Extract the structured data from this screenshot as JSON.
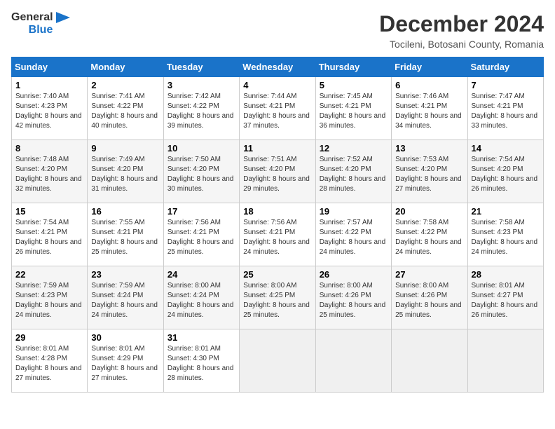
{
  "logo": {
    "text_general": "General",
    "text_blue": "Blue"
  },
  "title": {
    "month_year": "December 2024",
    "location": "Tocileni, Botosani County, Romania"
  },
  "weekdays": [
    "Sunday",
    "Monday",
    "Tuesday",
    "Wednesday",
    "Thursday",
    "Friday",
    "Saturday"
  ],
  "weeks": [
    [
      {
        "day": "1",
        "sunrise": "Sunrise: 7:40 AM",
        "sunset": "Sunset: 4:23 PM",
        "daylight": "Daylight: 8 hours and 42 minutes."
      },
      {
        "day": "2",
        "sunrise": "Sunrise: 7:41 AM",
        "sunset": "Sunset: 4:22 PM",
        "daylight": "Daylight: 8 hours and 40 minutes."
      },
      {
        "day": "3",
        "sunrise": "Sunrise: 7:42 AM",
        "sunset": "Sunset: 4:22 PM",
        "daylight": "Daylight: 8 hours and 39 minutes."
      },
      {
        "day": "4",
        "sunrise": "Sunrise: 7:44 AM",
        "sunset": "Sunset: 4:21 PM",
        "daylight": "Daylight: 8 hours and 37 minutes."
      },
      {
        "day": "5",
        "sunrise": "Sunrise: 7:45 AM",
        "sunset": "Sunset: 4:21 PM",
        "daylight": "Daylight: 8 hours and 36 minutes."
      },
      {
        "day": "6",
        "sunrise": "Sunrise: 7:46 AM",
        "sunset": "Sunset: 4:21 PM",
        "daylight": "Daylight: 8 hours and 34 minutes."
      },
      {
        "day": "7",
        "sunrise": "Sunrise: 7:47 AM",
        "sunset": "Sunset: 4:21 PM",
        "daylight": "Daylight: 8 hours and 33 minutes."
      }
    ],
    [
      {
        "day": "8",
        "sunrise": "Sunrise: 7:48 AM",
        "sunset": "Sunset: 4:20 PM",
        "daylight": "Daylight: 8 hours and 32 minutes."
      },
      {
        "day": "9",
        "sunrise": "Sunrise: 7:49 AM",
        "sunset": "Sunset: 4:20 PM",
        "daylight": "Daylight: 8 hours and 31 minutes."
      },
      {
        "day": "10",
        "sunrise": "Sunrise: 7:50 AM",
        "sunset": "Sunset: 4:20 PM",
        "daylight": "Daylight: 8 hours and 30 minutes."
      },
      {
        "day": "11",
        "sunrise": "Sunrise: 7:51 AM",
        "sunset": "Sunset: 4:20 PM",
        "daylight": "Daylight: 8 hours and 29 minutes."
      },
      {
        "day": "12",
        "sunrise": "Sunrise: 7:52 AM",
        "sunset": "Sunset: 4:20 PM",
        "daylight": "Daylight: 8 hours and 28 minutes."
      },
      {
        "day": "13",
        "sunrise": "Sunrise: 7:53 AM",
        "sunset": "Sunset: 4:20 PM",
        "daylight": "Daylight: 8 hours and 27 minutes."
      },
      {
        "day": "14",
        "sunrise": "Sunrise: 7:54 AM",
        "sunset": "Sunset: 4:20 PM",
        "daylight": "Daylight: 8 hours and 26 minutes."
      }
    ],
    [
      {
        "day": "15",
        "sunrise": "Sunrise: 7:54 AM",
        "sunset": "Sunset: 4:21 PM",
        "daylight": "Daylight: 8 hours and 26 minutes."
      },
      {
        "day": "16",
        "sunrise": "Sunrise: 7:55 AM",
        "sunset": "Sunset: 4:21 PM",
        "daylight": "Daylight: 8 hours and 25 minutes."
      },
      {
        "day": "17",
        "sunrise": "Sunrise: 7:56 AM",
        "sunset": "Sunset: 4:21 PM",
        "daylight": "Daylight: 8 hours and 25 minutes."
      },
      {
        "day": "18",
        "sunrise": "Sunrise: 7:56 AM",
        "sunset": "Sunset: 4:21 PM",
        "daylight": "Daylight: 8 hours and 24 minutes."
      },
      {
        "day": "19",
        "sunrise": "Sunrise: 7:57 AM",
        "sunset": "Sunset: 4:22 PM",
        "daylight": "Daylight: 8 hours and 24 minutes."
      },
      {
        "day": "20",
        "sunrise": "Sunrise: 7:58 AM",
        "sunset": "Sunset: 4:22 PM",
        "daylight": "Daylight: 8 hours and 24 minutes."
      },
      {
        "day": "21",
        "sunrise": "Sunrise: 7:58 AM",
        "sunset": "Sunset: 4:23 PM",
        "daylight": "Daylight: 8 hours and 24 minutes."
      }
    ],
    [
      {
        "day": "22",
        "sunrise": "Sunrise: 7:59 AM",
        "sunset": "Sunset: 4:23 PM",
        "daylight": "Daylight: 8 hours and 24 minutes."
      },
      {
        "day": "23",
        "sunrise": "Sunrise: 7:59 AM",
        "sunset": "Sunset: 4:24 PM",
        "daylight": "Daylight: 8 hours and 24 minutes."
      },
      {
        "day": "24",
        "sunrise": "Sunrise: 8:00 AM",
        "sunset": "Sunset: 4:24 PM",
        "daylight": "Daylight: 8 hours and 24 minutes."
      },
      {
        "day": "25",
        "sunrise": "Sunrise: 8:00 AM",
        "sunset": "Sunset: 4:25 PM",
        "daylight": "Daylight: 8 hours and 25 minutes."
      },
      {
        "day": "26",
        "sunrise": "Sunrise: 8:00 AM",
        "sunset": "Sunset: 4:26 PM",
        "daylight": "Daylight: 8 hours and 25 minutes."
      },
      {
        "day": "27",
        "sunrise": "Sunrise: 8:00 AM",
        "sunset": "Sunset: 4:26 PM",
        "daylight": "Daylight: 8 hours and 25 minutes."
      },
      {
        "day": "28",
        "sunrise": "Sunrise: 8:01 AM",
        "sunset": "Sunset: 4:27 PM",
        "daylight": "Daylight: 8 hours and 26 minutes."
      }
    ],
    [
      {
        "day": "29",
        "sunrise": "Sunrise: 8:01 AM",
        "sunset": "Sunset: 4:28 PM",
        "daylight": "Daylight: 8 hours and 27 minutes."
      },
      {
        "day": "30",
        "sunrise": "Sunrise: 8:01 AM",
        "sunset": "Sunset: 4:29 PM",
        "daylight": "Daylight: 8 hours and 27 minutes."
      },
      {
        "day": "31",
        "sunrise": "Sunrise: 8:01 AM",
        "sunset": "Sunset: 4:30 PM",
        "daylight": "Daylight: 8 hours and 28 minutes."
      },
      null,
      null,
      null,
      null
    ]
  ],
  "colors": {
    "header_bg": "#1a73c9",
    "header_text": "#ffffff"
  }
}
